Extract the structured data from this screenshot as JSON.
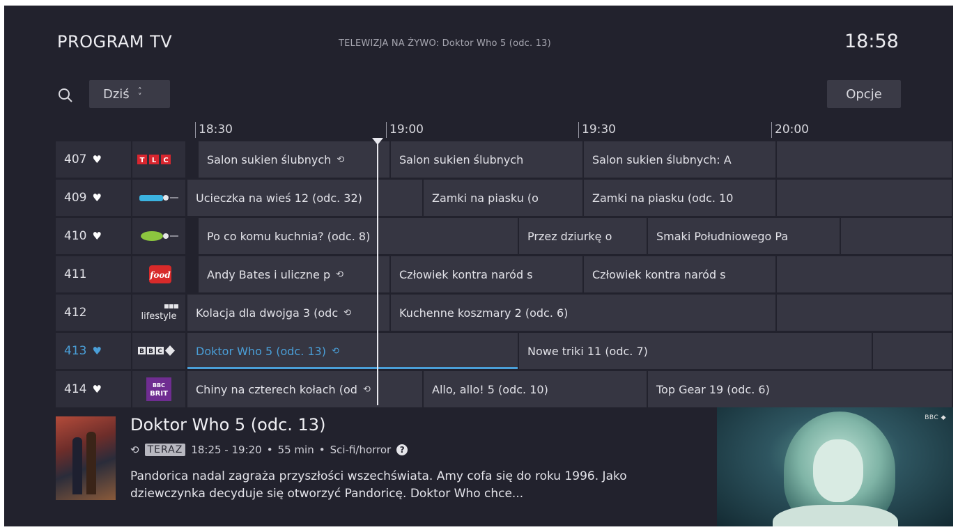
{
  "header": {
    "title": "PROGRAM TV",
    "live_text": "TELEWIZJA NA ŻYWO: Doktor Who 5 (odc. 13)",
    "clock": "18:58"
  },
  "toolbar": {
    "search_icon": "search-icon",
    "day_label": "Dziś",
    "options_label": "Opcje"
  },
  "timeline": [
    "18:30",
    "19:00",
    "19:30",
    "20:00"
  ],
  "channels": [
    {
      "number": "407",
      "logo": "TLC",
      "favorite": true,
      "programs": [
        "Salon sukien ślubnych",
        "Salon sukien ślubnych",
        "Salon sukien ślubnych: A",
        ""
      ]
    },
    {
      "number": "409",
      "logo": "",
      "favorite": true,
      "programs": [
        "Ucieczka na wieś 12 (odc. 32)",
        "Zamki na piasku (o",
        "Zamki na piasku (odc. 10",
        ""
      ]
    },
    {
      "number": "410",
      "logo": "",
      "favorite": true,
      "programs": [
        "Po co komu kuchnia? (odc. 8)",
        "Przez dziurkę o",
        "Smaki Południowego Pa",
        ""
      ]
    },
    {
      "number": "411",
      "logo": "food",
      "favorite": false,
      "programs": [
        "Andy Bates i uliczne p",
        "Człowiek kontra naród s",
        "Człowiek kontra naród s",
        ""
      ]
    },
    {
      "number": "412",
      "logo": "lifestyle",
      "favorite": false,
      "programs": [
        "Kolacja dla dwojga 3 (odc",
        "Kuchenne koszmary 2 (odc. 6)",
        ""
      ]
    },
    {
      "number": "413",
      "logo": "BBC",
      "favorite": true,
      "programs": [
        "Doktor Who 5 (odc. 13)",
        "Nowe triki 11 (odc. 7)",
        ""
      ]
    },
    {
      "number": "414",
      "logo": "BBC BRIT",
      "favorite": true,
      "programs": [
        "Chiny na czterech kołach (od",
        "Allo, allo! 5 (odc. 10)",
        "Top Gear 19 (odc. 6)"
      ]
    }
  ],
  "details": {
    "title": "Doktor Who 5 (odc. 13)",
    "badge": "TERAZ",
    "time": "18:25 - 19:20",
    "duration": "55 min",
    "genre": "Sci-fi/horror",
    "description": "Pandorica nadal zagraża przyszłości wszechświata. Amy cofa się do roku 1996. Jako dziewczynka decyduje się otworzyć Pandoricę. Doktor Who chce..."
  },
  "colors": {
    "background": "#22222d",
    "cell": "#363642",
    "accent": "#4a9fd8"
  }
}
